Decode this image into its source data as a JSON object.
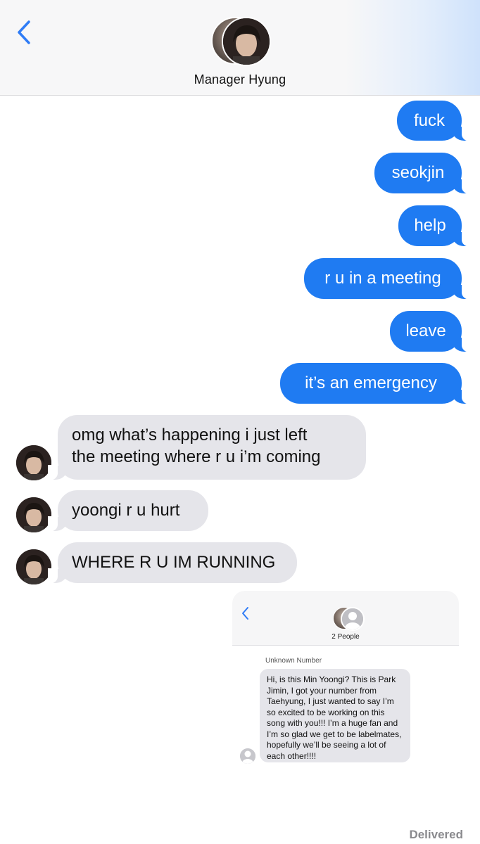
{
  "header": {
    "contact_name": "Manager Hyung"
  },
  "messages": [
    {
      "direction": "outgoing",
      "text": "fuck"
    },
    {
      "direction": "outgoing",
      "text": "seokjin"
    },
    {
      "direction": "outgoing",
      "text": "help"
    },
    {
      "direction": "outgoing",
      "text": "r u in a meeting"
    },
    {
      "direction": "outgoing",
      "text": "leave"
    },
    {
      "direction": "outgoing",
      "text": "it’s an emergency"
    },
    {
      "direction": "incoming",
      "lines": [
        "omg what’s happening i just left",
        "the meeting where r u i’m coming"
      ]
    },
    {
      "direction": "incoming",
      "text": "yoongi r u hurt"
    },
    {
      "direction": "incoming",
      "text": "WHERE R U IM RUNNING"
    }
  ],
  "attachment_screenshot": {
    "group_label": "2 People",
    "sender_label": "Unknown Number",
    "message": "Hi, is this Min Yoongi? This is Park Jimin, I got your number from Taehyung, I just wanted to say I’m so excited to be working on this song with you!!! I’m a huge fan and I’m so glad we get to be labelmates, hopefully we’ll be seeing a lot of each other!!!!"
  },
  "status": "Delivered",
  "colors": {
    "outgoing_bubble": "#1f7bf2",
    "incoming_bubble": "#e5e5ea",
    "accent": "#2f7cf6"
  }
}
